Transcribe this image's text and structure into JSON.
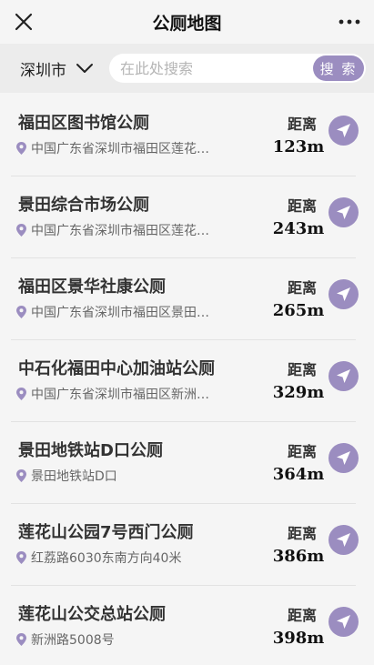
{
  "header": {
    "title": "公厕地图"
  },
  "search": {
    "city": "深圳市",
    "placeholder": "在此处搜索",
    "button_label": "搜 索"
  },
  "colors": {
    "accent": "#9b8dc0",
    "background": "#f5f5f5",
    "search_bar_bg": "#ececec"
  },
  "icons": {
    "close": "close-icon",
    "more": "more-dots-icon",
    "city_dropdown": "chevron-down-icon",
    "location": "map-pin-icon",
    "navigate": "navigation-arrow-icon"
  },
  "toilets": [
    {
      "name": "福田区图书馆公厕",
      "address": "中国广东省深圳市福田区莲花…",
      "distance_label": "距离",
      "distance": "123m"
    },
    {
      "name": "景田综合市场公厕",
      "address": "中国广东省深圳市福田区莲花…",
      "distance_label": "距离",
      "distance": "243m"
    },
    {
      "name": "福田区景华社康公厕",
      "address": "中国广东省深圳市福田区景田…",
      "distance_label": "距离",
      "distance": "265m"
    },
    {
      "name": "中石化福田中心加油站公厕",
      "address": "中国广东省深圳市福田区新洲…",
      "distance_label": "距离",
      "distance": "329m"
    },
    {
      "name": "景田地铁站D口公厕",
      "address": "景田地铁站D口",
      "distance_label": "距离",
      "distance": "364m"
    },
    {
      "name": "莲花山公园7号西门公厕",
      "address": "红荔路6030东南方向40米",
      "distance_label": "距离",
      "distance": "386m"
    },
    {
      "name": "莲花山公交总站公厕",
      "address": "新洲路5008号",
      "distance_label": "距离",
      "distance": "398m"
    }
  ]
}
